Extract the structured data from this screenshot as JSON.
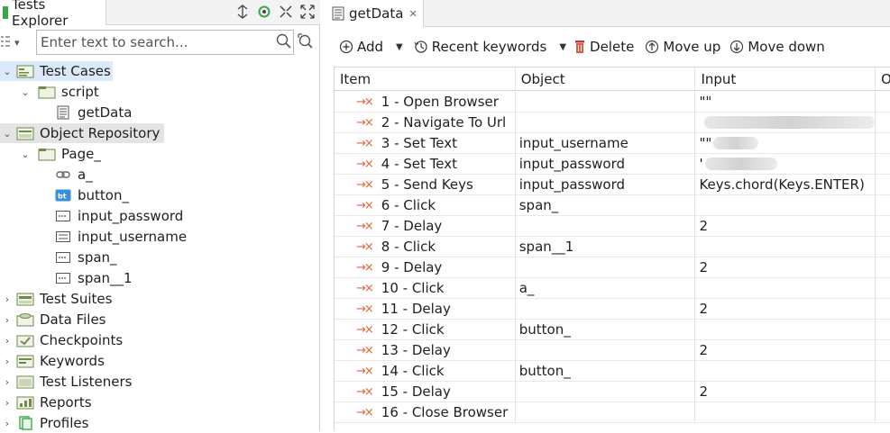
{
  "explorer": {
    "title": "Tests Explorer",
    "search_placeholder": "Enter text to search...",
    "tree": {
      "test_cases": "Test Cases",
      "script": "script",
      "getdata": "getData",
      "object_repository": "Object Repository",
      "page": "Page_",
      "a": "a_",
      "button": "button_",
      "input_password": "input_password",
      "input_username": "input_username",
      "span": "span_",
      "span1": "span__1",
      "test_suites": "Test Suites",
      "data_files": "Data Files",
      "checkpoints": "Checkpoints",
      "keywords": "Keywords",
      "test_listeners": "Test Listeners",
      "reports": "Reports",
      "profiles": "Profiles"
    }
  },
  "editor": {
    "tab_label": "getData",
    "toolbar": {
      "add": "Add",
      "recent_keywords": "Recent keywords",
      "delete": "Delete",
      "move_up": "Move up",
      "move_down": "Move down"
    },
    "columns": {
      "item": "Item",
      "object": "Object",
      "input": "Input",
      "more": "O"
    },
    "rows": [
      {
        "item": "1 - Open Browser",
        "object": "",
        "input": "\"\""
      },
      {
        "item": "2 - Navigate To Url",
        "object": "",
        "input": ""
      },
      {
        "item": "3 - Set Text",
        "object": "input_username",
        "input": "\"\""
      },
      {
        "item": "4 - Set Text",
        "object": "input_password",
        "input": "'"
      },
      {
        "item": "5 - Send Keys",
        "object": "input_password",
        "input": "Keys.chord(Keys.ENTER)"
      },
      {
        "item": "6 - Click",
        "object": "span_",
        "input": ""
      },
      {
        "item": "7 - Delay",
        "object": "",
        "input": "2"
      },
      {
        "item": "8 - Click",
        "object": "span__1",
        "input": ""
      },
      {
        "item": "9 - Delay",
        "object": "",
        "input": "2"
      },
      {
        "item": "10 - Click",
        "object": "a_",
        "input": ""
      },
      {
        "item": "11 - Delay",
        "object": "",
        "input": "2"
      },
      {
        "item": "12 - Click",
        "object": "button_",
        "input": ""
      },
      {
        "item": "13 - Delay",
        "object": "",
        "input": "2"
      },
      {
        "item": "14 - Click",
        "object": "button_",
        "input": ""
      },
      {
        "item": "15 - Delay",
        "object": "",
        "input": "2"
      },
      {
        "item": "16 - Close Browser",
        "object": "",
        "input": ""
      }
    ]
  },
  "colors": {
    "step_icon": "#e0663a",
    "selection_blue": "#dbeaf8",
    "selection_grey": "#e4e4e4"
  }
}
